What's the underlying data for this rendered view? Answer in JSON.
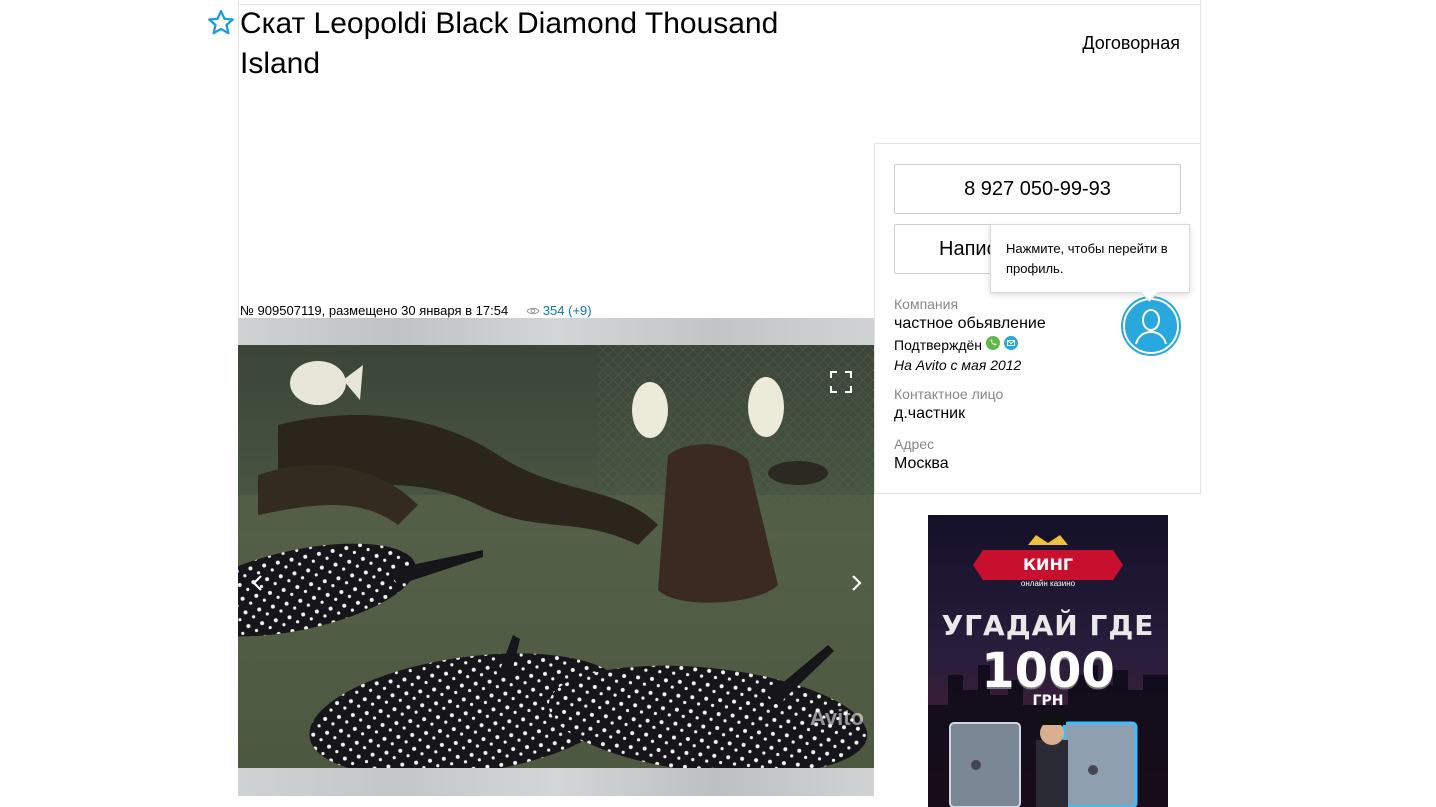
{
  "listing": {
    "title": "Скат Leopoldi Black Diamond Thousand Island",
    "price": "Договорная",
    "meta": "№ 909507119, размещено 30 января в 17:54",
    "views": "354 (+9)",
    "photo_watermark": "Avito"
  },
  "contact": {
    "phone": "8 927 050-99-93",
    "write_label": "Написать сообщение",
    "tooltip": "Нажмите, чтобы перейти в профиль.",
    "company_label": "Компания",
    "company_value": "частное обьявление",
    "verified_label": "Подтверждён",
    "since": "На Avito с мая 2012",
    "person_label": "Контактное лицо",
    "person_value": "д.частник",
    "address_label": "Адрес",
    "address_value": "Москва"
  },
  "ad": {
    "brand": "КИНГ",
    "brand_sub": "онлайн казино",
    "headline": "УГАДАЙ ГДЕ",
    "amount": "1000",
    "currency": "ГРН"
  },
  "colors": {
    "link": "#0a78b4",
    "avatar": "#29a8e0",
    "star": "#1a9be6"
  },
  "icons": [
    "star-icon",
    "eye-icon",
    "fullscreen-icon",
    "chevron-left-icon",
    "chevron-right-icon",
    "phone-verified-icon",
    "email-verified-icon",
    "user-avatar-icon"
  ]
}
